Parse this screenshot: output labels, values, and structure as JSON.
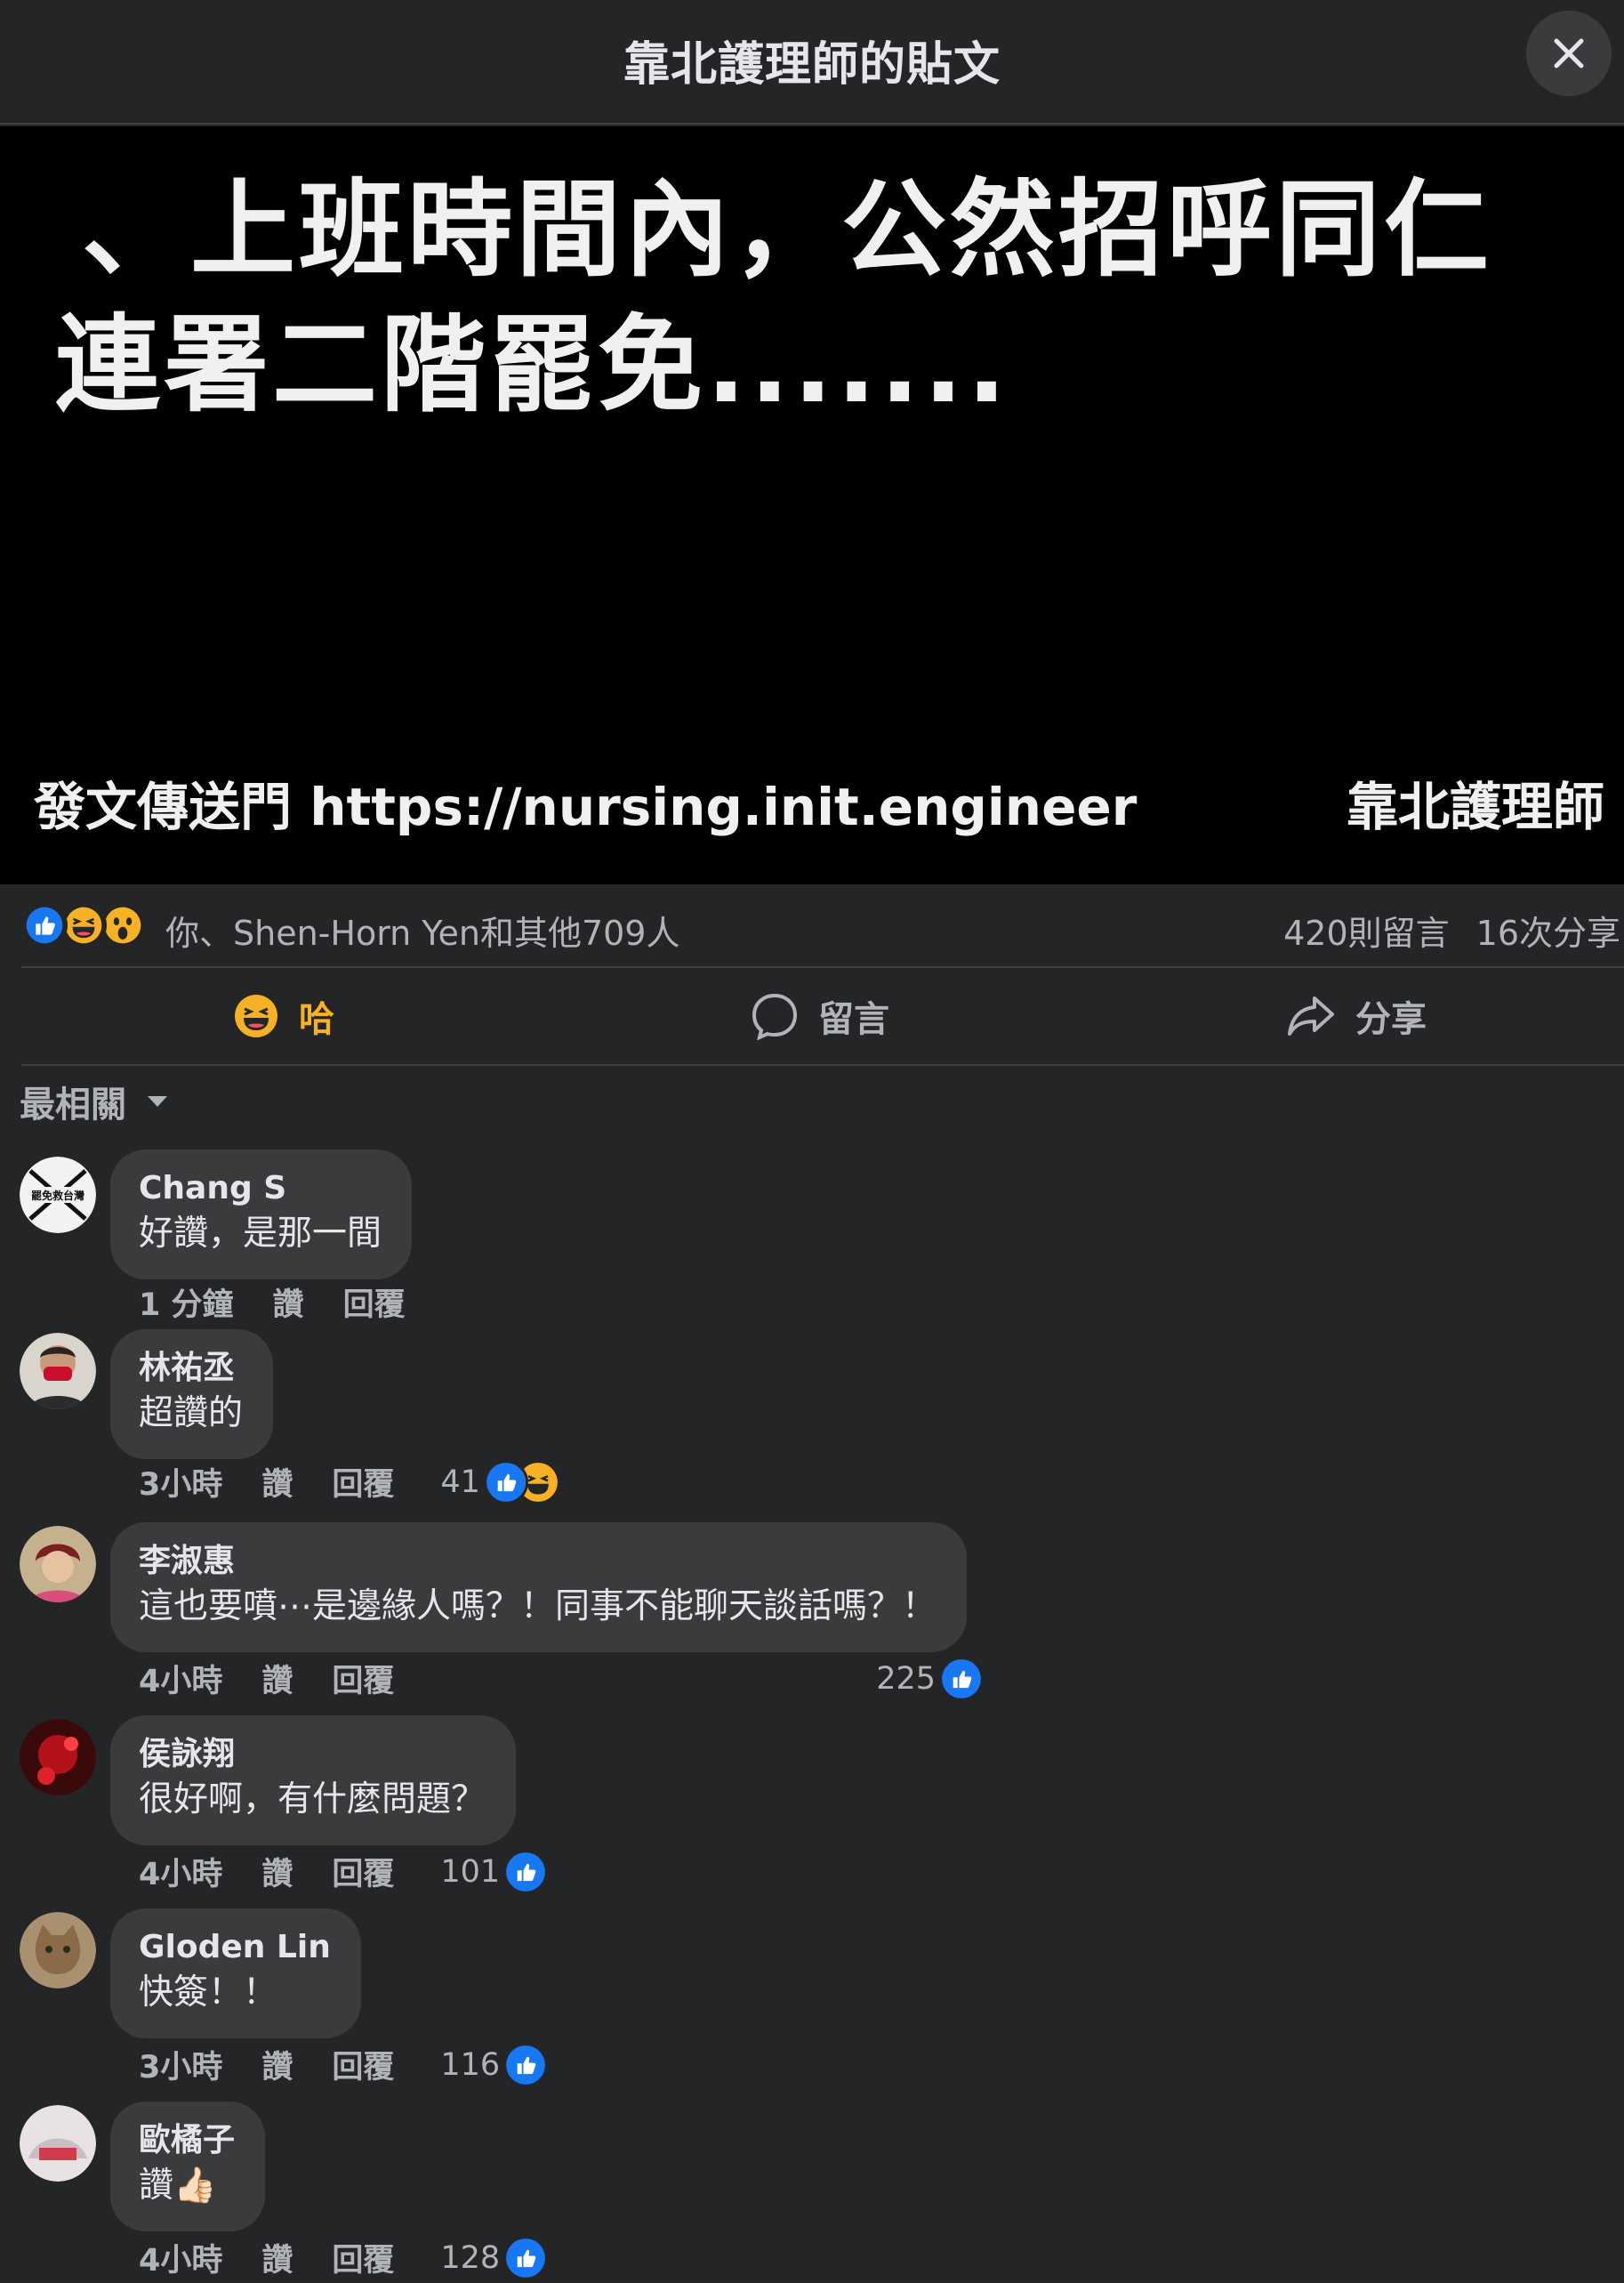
{
  "header": {
    "title": "靠北護理師的貼文",
    "close_icon": "close-icon"
  },
  "post": {
    "line1": "、上班時間內，公然招呼同仁",
    "line2": "連署二階罷免.......",
    "footer_left": "發文傳送門 https://nursing.init.engineer",
    "footer_right": "靠北護理師"
  },
  "summary": {
    "reactions": [
      "like",
      "haha",
      "wow"
    ],
    "names": "你、Shen-Horn Yen和其他709人",
    "comments": "420則留言",
    "shares": "16次分享"
  },
  "actions": {
    "haha": "哈",
    "comment": "留言",
    "share": "分享"
  },
  "sort": {
    "label": "最相關"
  },
  "comments": [
    {
      "name": "Chang S",
      "text": "好讚，是那一間",
      "time": "1 分鐘",
      "like": "讚",
      "reply": "回覆",
      "count": ""
    },
    {
      "name": "林祐丞",
      "text": "超讚的",
      "time": "3小時",
      "like": "讚",
      "reply": "回覆",
      "count": "41"
    },
    {
      "name": "李淑惠",
      "text": "這也要噴⋯是邊緣人嗎？！同事不能聊天談話嗎？！",
      "time": "4小時",
      "like": "讚",
      "reply": "回覆",
      "count": "225"
    },
    {
      "name": "侯詠翔",
      "text": "很好啊，有什麼問題？",
      "time": "4小時",
      "like": "讚",
      "reply": "回覆",
      "count": "101"
    },
    {
      "name": "Gloden Lin",
      "text": "快簽！！",
      "time": "3小時",
      "like": "讚",
      "reply": "回覆",
      "count": "116"
    },
    {
      "name": "歐橘子",
      "text": "讚👍🏻",
      "time": "4小時",
      "like": "讚",
      "reply": "回覆",
      "count": "128"
    }
  ],
  "colors": {
    "background": "#242526",
    "bubble": "#3a3b3c",
    "like_blue": "#1877f2",
    "haha_yellow": "#f7b125"
  }
}
